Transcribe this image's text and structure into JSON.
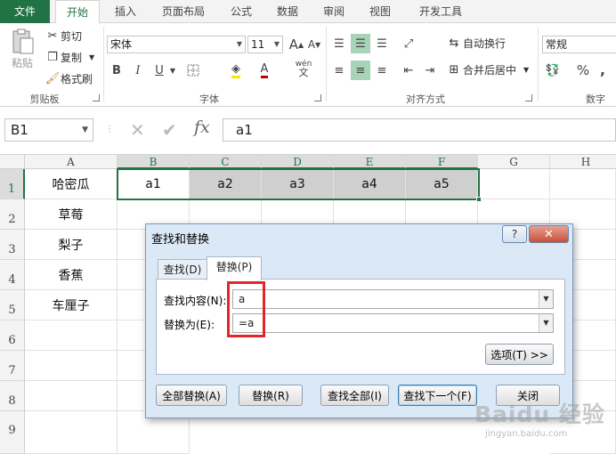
{
  "tabs": [
    "文件",
    "开始",
    "插入",
    "页面布局",
    "公式",
    "数据",
    "审阅",
    "视图",
    "开发工具"
  ],
  "ribbon": {
    "clipboard": {
      "paste": "粘贴",
      "cut": "剪切",
      "copy": "复制",
      "format_painter": "格式刷",
      "label": "剪贴板"
    },
    "font": {
      "name": "宋体",
      "size": "11",
      "grow": "A",
      "shrink": "A",
      "bold": "B",
      "italic": "I",
      "underline": "U",
      "font_color": "A",
      "wen": "wén",
      "label": "字体"
    },
    "alignment": {
      "wrap_text": "自动换行",
      "merge_center": "合并后居中",
      "label": "对齐方式"
    },
    "number": {
      "format": "常规",
      "percent": "%",
      "comma": ",",
      "label": "数字"
    }
  },
  "formula_bar": {
    "name_box": "B1",
    "cancel": "✕",
    "enter": "✔",
    "fx": "fx",
    "content": "a1"
  },
  "columns": [
    "A",
    "B",
    "C",
    "D",
    "E",
    "F",
    "G",
    "H"
  ],
  "rows": [
    "1",
    "2",
    "3",
    "4",
    "5",
    "6",
    "7",
    "8",
    "9"
  ],
  "cells": {
    "A1": "哈密瓜",
    "A2": "草莓",
    "A3": "梨子",
    "A4": "香蕉",
    "A5": "车厘子",
    "B1": "a1",
    "C1": "a2",
    "D1": "a3",
    "E1": "a4",
    "F1": "a5"
  },
  "dialog": {
    "title": "查找和替换",
    "help": "?",
    "close": "✕",
    "tab_find": "查找(D)",
    "tab_replace": "替换(P)",
    "find_label": "查找内容(N):",
    "find_value": "a",
    "replace_label": "替换为(E):",
    "replace_value": "=a",
    "options": "选项(T) >>",
    "replace_all": "全部替换(A)",
    "replace": "替换(R)",
    "find_all": "查找全部(I)",
    "find_next": "查找下一个(F)",
    "close_btn": "关闭"
  },
  "watermark": {
    "text": "Baidu 经验",
    "url": "jingyan.baidu.com"
  },
  "colors": {
    "accent": "#217346",
    "highlight": "#e4262a"
  }
}
